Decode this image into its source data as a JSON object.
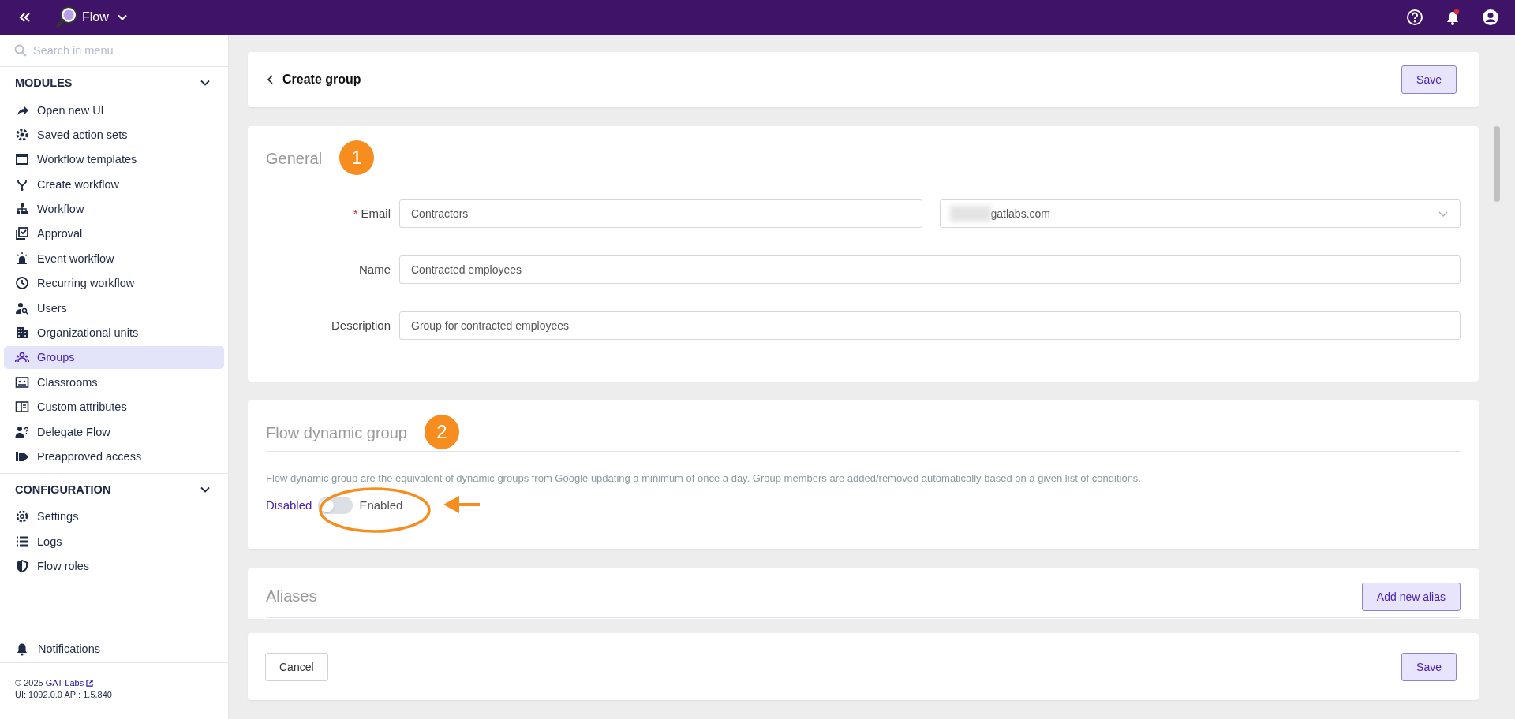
{
  "topbar": {
    "app_name": "Flow"
  },
  "sidebar": {
    "search": {
      "placeholder": "Search in menu"
    },
    "sections": [
      {
        "title": "MODULES",
        "expanded": true,
        "items": [
          {
            "label": "Open new UI",
            "selected": false
          },
          {
            "label": "Saved action sets",
            "selected": false
          },
          {
            "label": "Workflow templates",
            "selected": false
          },
          {
            "label": "Create workflow",
            "selected": false
          },
          {
            "label": "Workflow",
            "selected": false
          },
          {
            "label": "Approval",
            "selected": false
          },
          {
            "label": "Event workflow",
            "selected": false
          },
          {
            "label": "Recurring workflow",
            "selected": false
          },
          {
            "label": "Users",
            "selected": false
          },
          {
            "label": "Organizational units",
            "selected": false
          },
          {
            "label": "Groups",
            "selected": true
          },
          {
            "label": "Classrooms",
            "selected": false
          },
          {
            "label": "Custom attributes",
            "selected": false
          },
          {
            "label": "Delegate Flow",
            "selected": false
          },
          {
            "label": "Preapproved access",
            "selected": false
          }
        ]
      },
      {
        "title": "CONFIGURATION",
        "expanded": true,
        "items": [
          {
            "label": "Settings",
            "selected": false
          },
          {
            "label": "Logs",
            "selected": false
          },
          {
            "label": "Flow roles",
            "selected": false
          }
        ]
      }
    ],
    "notifications": "Notifications",
    "footer": {
      "copyright": "© 2025",
      "link": "GAT Labs",
      "version": "UI: 1092.0.0 API: 1.5.840"
    }
  },
  "header": {
    "title": "Create group",
    "save": "Save"
  },
  "general": {
    "title": "General",
    "badge": "1",
    "email": {
      "label": "Email",
      "required_mark": "*",
      "value": "Contractors",
      "domain": "gatlabs.com"
    },
    "fields": [
      {
        "label": "Name",
        "value": "Contracted employees"
      },
      {
        "label": "Description",
        "value": "Group for contracted employees"
      }
    ]
  },
  "dynamic": {
    "title": "Flow dynamic group",
    "badge": "2",
    "description": "Flow dynamic group are the equivalent of dynamic groups from Google updating a minimum of once a day. Group members are added/removed automatically based on a given list of conditions.",
    "off_label": "Disabled",
    "on_label": "Enabled",
    "on": false
  },
  "aliases": {
    "title": "Aliases",
    "add": "Add new alias"
  },
  "footer": {
    "cancel": "Cancel",
    "save": "Save"
  }
}
